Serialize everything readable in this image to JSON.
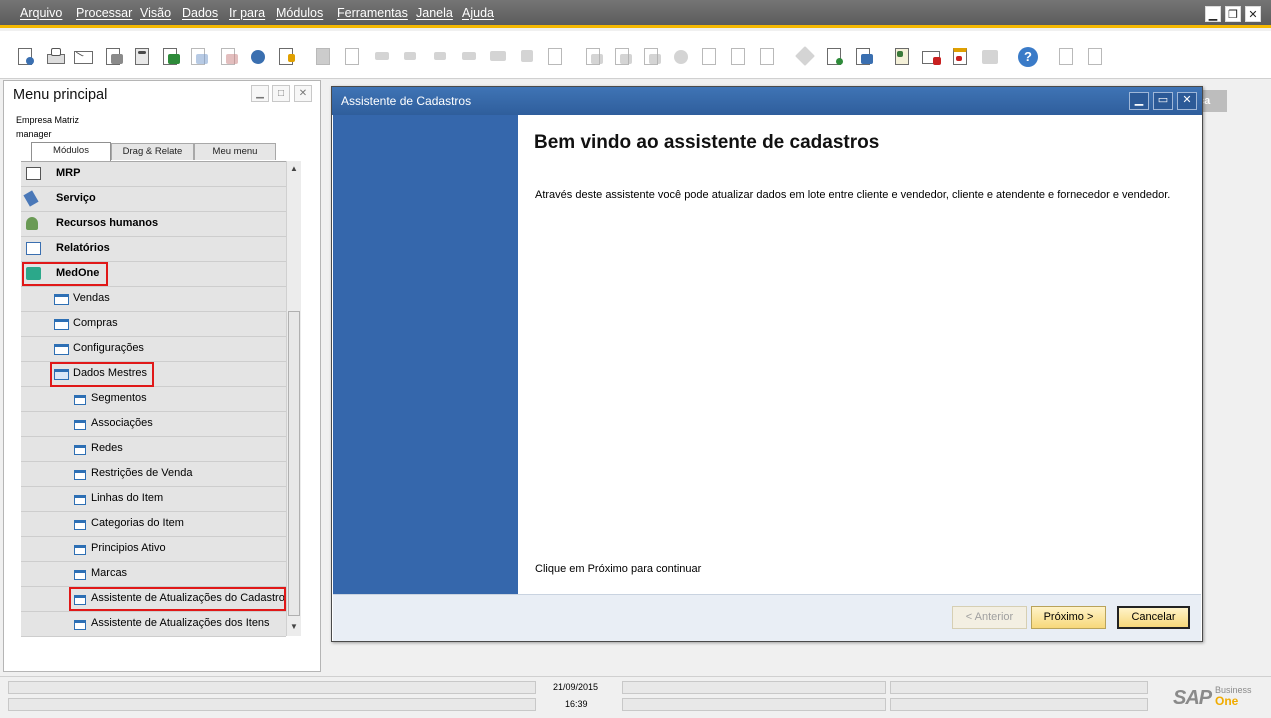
{
  "menubar": {
    "items": [
      "Arquivo",
      "Processar",
      "Visão",
      "Dados",
      "Ir para",
      "Módulos",
      "Ferramentas",
      "Janela",
      "Ajuda"
    ]
  },
  "toolbar": {
    "icons": [
      "print-preview-icon",
      "print-icon",
      "email-icon",
      "send-icon",
      "calculator-icon",
      "export-excel-icon",
      "export-word-icon",
      "export-pdf-icon",
      "drag-relate-icon",
      "lock-icon",
      "find-icon",
      "add-icon",
      "first-record-icon",
      "previous-record-icon",
      "next-record-icon",
      "last-record-icon",
      "refresh-icon",
      "filter-icon",
      "sort-icon",
      "base-document-icon",
      "target-document-icon",
      "journal-icon",
      "gross-profit-icon",
      "balance-icon",
      "payment-means-icon",
      "exchange-rates-icon",
      "settings-icon",
      "form-settings-icon",
      "queries-icon",
      "messages-icon",
      "alerts-icon",
      "calendar-icon",
      "org-chart-icon",
      "help-icon",
      "print-layout-icon",
      "layout-designer-icon"
    ]
  },
  "left_panel": {
    "title": "Menu principal",
    "company": "Empresa Matriz",
    "user": "manager",
    "tabs": [
      "Módulos",
      "Drag & Relate",
      "Meu menu"
    ],
    "tree": [
      {
        "label": "MRP",
        "icon": "mrp-icon",
        "level": 0
      },
      {
        "label": "Serviço",
        "icon": "service-icon",
        "level": 0
      },
      {
        "label": "Recursos humanos",
        "icon": "human-resources-icon",
        "level": 0
      },
      {
        "label": "Relatórios",
        "icon": "reports-icon",
        "level": 0
      },
      {
        "label": "MedOne",
        "icon": "medone-icon",
        "level": 0
      },
      {
        "label": "Vendas",
        "icon": "folder-icon",
        "level": 1
      },
      {
        "label": "Compras",
        "icon": "folder-icon",
        "level": 1
      },
      {
        "label": "Configurações",
        "icon": "folder-icon",
        "level": 1
      },
      {
        "label": "Dados Mestres",
        "icon": "folder-open-icon",
        "level": 1
      },
      {
        "label": "Segmentos",
        "icon": "form-icon",
        "level": 2
      },
      {
        "label": "Associações",
        "icon": "form-icon",
        "level": 2
      },
      {
        "label": "Redes",
        "icon": "form-icon",
        "level": 2
      },
      {
        "label": "Restrições de Venda",
        "icon": "form-icon",
        "level": 2
      },
      {
        "label": "Linhas do Item",
        "icon": "form-icon",
        "level": 2
      },
      {
        "label": "Categorias do Item",
        "icon": "form-icon",
        "level": 2
      },
      {
        "label": "Principios Ativo",
        "icon": "form-icon",
        "level": 2
      },
      {
        "label": "Marcas",
        "icon": "form-icon",
        "level": 2
      },
      {
        "label": "Assistente de Atualizações do Cadastro",
        "icon": "form-icon",
        "level": 2
      },
      {
        "label": "Assistente de Atualizações dos Itens",
        "icon": "form-icon",
        "level": 2
      }
    ]
  },
  "dialog": {
    "title": "Assistente de Cadastros",
    "heading": "Bem vindo ao assistente de cadastros",
    "body": "Através deste assistente você pode atualizar dados em lote entre cliente e vendedor, cliente e atendente e fornecedor e vendedor.",
    "footer_hint": "Clique em Próximo para continuar",
    "buttons": {
      "previous": "< Anterior",
      "next": "Próximo >",
      "cancel": "Cancelar"
    }
  },
  "background_window": {
    "fragment": "ca"
  },
  "statusbar": {
    "date": "21/09/2015",
    "time": "16:39",
    "brand": "SAP",
    "brand_line1": "Business",
    "brand_line2": "One"
  },
  "colors": {
    "menubar": "#666666",
    "accent": "#f5b800",
    "dialog_title": "#3a6cae",
    "dialog_side": "#3567ac",
    "highlight": "#e01818",
    "button": "#f7d87a"
  }
}
